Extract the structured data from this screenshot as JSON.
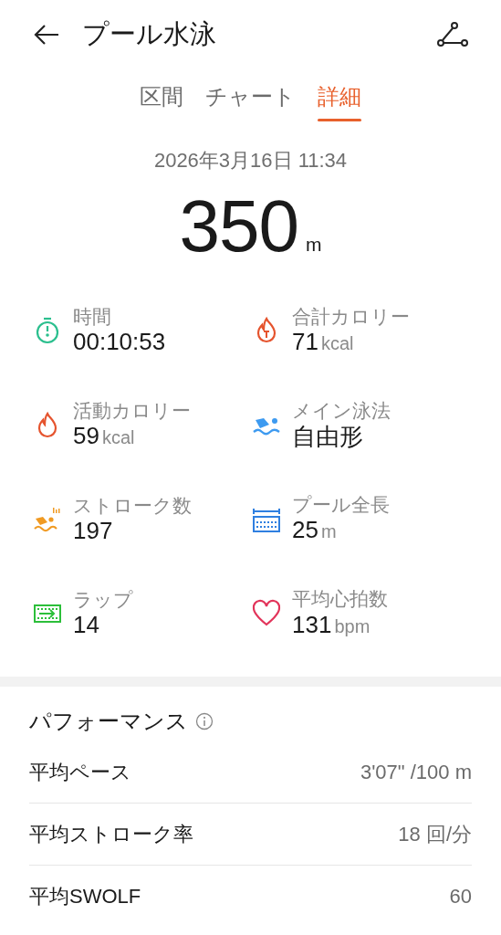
{
  "header": {
    "title": "プール水泳"
  },
  "tabs": [
    {
      "label": "区間",
      "selected": false
    },
    {
      "label": "チャート",
      "selected": false
    },
    {
      "label": "詳細",
      "selected": true
    }
  ],
  "date": "2026年3月16日 11:34",
  "distance": {
    "value": "350",
    "unit": "m"
  },
  "stats": [
    {
      "label": "時間",
      "value": "00:10:53"
    },
    {
      "label": "合計カロリー",
      "value": "71",
      "unit": "kcal"
    },
    {
      "label": "活動カロリー",
      "value": "59",
      "unit": "kcal"
    },
    {
      "label": "メイン泳法",
      "value": "自由形"
    },
    {
      "label": "ストローク数",
      "value": "197"
    },
    {
      "label": "プール全長",
      "value": "25",
      "unit": "m"
    },
    {
      "label": "ラップ",
      "value": "14"
    },
    {
      "label": "平均心拍数",
      "value": "131",
      "unit": "bpm"
    }
  ],
  "performance": {
    "title": "パフォーマンス",
    "rows": [
      {
        "label": "平均ペース",
        "value": "3'07\" /100 m"
      },
      {
        "label": "平均ストローク率",
        "value": "18 回/分"
      },
      {
        "label": "平均SWOLF",
        "value": "60"
      }
    ]
  }
}
